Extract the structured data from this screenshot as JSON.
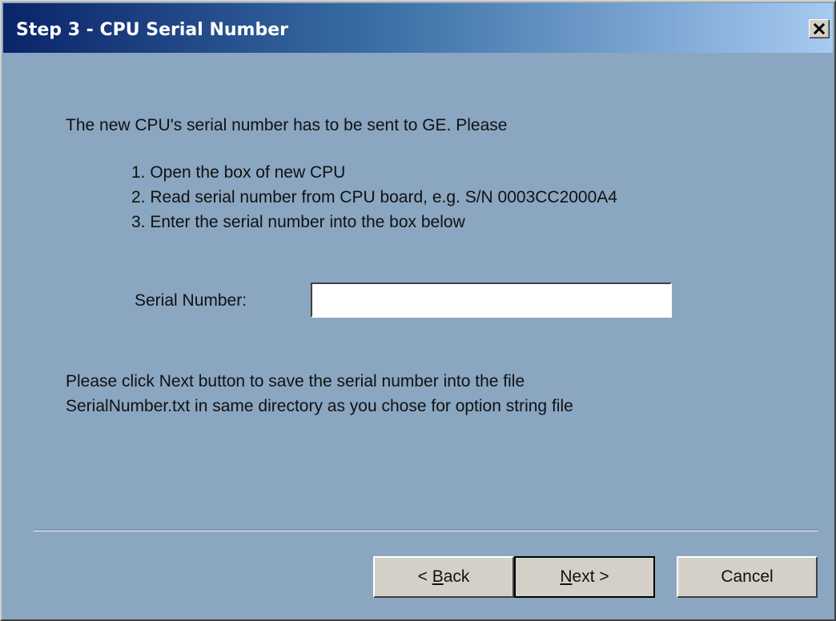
{
  "window": {
    "title": "Step 3 - CPU Serial Number",
    "close_icon": "close-icon"
  },
  "content": {
    "intro": "The new CPU's serial number has to be sent to GE. Please",
    "steps": [
      "1. Open the box of new CPU",
      "2. Read serial number from CPU board, e.g. S/N 0003CC2000A4",
      "3. Enter the serial number into the box below"
    ],
    "serial_label": "Serial Number:",
    "serial_value": "",
    "note_lines": [
      "Please click Next button to save the serial number into the file",
      "SerialNumber.txt in same directory as you chose for option string file"
    ]
  },
  "buttons": {
    "back_prefix": "< ",
    "back_mnemonic": "B",
    "back_rest": "ack",
    "next_mnemonic": "N",
    "next_rest": "ext >",
    "cancel": "Cancel"
  }
}
